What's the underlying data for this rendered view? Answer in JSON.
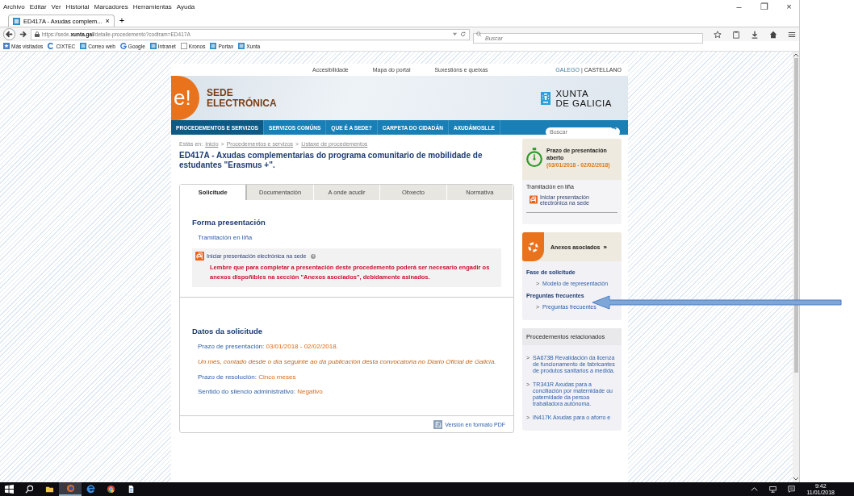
{
  "browser": {
    "menu": [
      "Archivo",
      "Editar",
      "Ver",
      "Historial",
      "Marcadores",
      "Herramientas",
      "Ayuda"
    ],
    "window_controls": [
      "–",
      "❐",
      "×"
    ],
    "tab": {
      "title": "ED417A - Axudas complem...",
      "close": "×",
      "new_tab": "+"
    },
    "address": "https://sede.**xunta.gal**/detalle-procedemento?codtram=ED417A",
    "search": {
      "placeholder": "Buscar"
    },
    "bookmarks": [
      {
        "label": "Más visitados",
        "kind": "star"
      },
      {
        "label": "CIXTEC",
        "kind": "c"
      },
      {
        "label": "Correo web",
        "kind": "page"
      },
      {
        "label": "Google",
        "kind": "g"
      },
      {
        "label": "Intranet",
        "kind": "page"
      },
      {
        "label": "Kronos",
        "kind": "blank"
      },
      {
        "label": "Portax",
        "kind": "page"
      },
      {
        "label": "Xunta",
        "kind": "page"
      }
    ]
  },
  "site": {
    "top_links": [
      "Accesibilidade",
      "Mapa do portal",
      "Suxestións e queixas"
    ],
    "languages": [
      {
        "label": "GALEGO",
        "selected": true
      },
      {
        "label": "CASTELLANO",
        "selected": false
      }
    ],
    "separator": "|",
    "logo": {
      "mark": "e!",
      "lines": [
        "SEDE",
        "ELECTRÓNICA"
      ]
    },
    "xunta": [
      "XUNTA",
      "DE GALICIA"
    ],
    "nav": [
      {
        "label": "PROCEDEMENTOS E SERVIZOS",
        "selected": true
      },
      {
        "label": "SERVIZOS COMÚNS",
        "selected": false
      },
      {
        "label": "QUE É A SEDE?",
        "selected": false
      },
      {
        "label": "CARPETA DO CIDADÁN",
        "selected": false
      },
      {
        "label": "AXUDÁMOSLLE",
        "selected": false
      }
    ],
    "search": {
      "placeholder": "Buscar"
    },
    "breadcrumb": {
      "label": "Estás en:",
      "links": [
        "Inicio",
        "Procedementos e servizos",
        "Listaxe de procedementos"
      ],
      "separator": ">"
    },
    "title": "ED417A - Axudas complementarias do programa comunitario de mobilidade de estudantes \"Erasmus +\".",
    "tabs": [
      {
        "label": "Solicitude",
        "selected": true
      },
      {
        "label": "Documentación",
        "selected": false
      },
      {
        "label": "A onde acudir",
        "selected": false
      },
      {
        "label": "Obxecto",
        "selected": false
      },
      {
        "label": "Normativa",
        "selected": false
      }
    ],
    "forma": {
      "heading": "Forma presentación",
      "subheading": "Tramitación en liña",
      "link": "Iniciar presentación electrónica na sede",
      "warning": "Lembre que para completar a presentación deste procedemento poderá ser necesario engadir os anexos dispoñibles na sección \"Anexos asociados\", debidamente asinados."
    },
    "datos": {
      "heading": "Datos da solicitude",
      "fields": [
        {
          "label": "Prazo de presentación:",
          "value": "03/01/2018 - 02/02/2018."
        },
        {
          "label": "Prazo de resolución:",
          "value": "Cinco meses"
        },
        {
          "label": "Sentido do silencio administrativo:",
          "value": "Negativo"
        }
      ],
      "note": "Un mes, contado desde o día seguinte ao da publicación desta convocatoria no Diario Oficial de Galicia."
    },
    "pdf_link": "Versión en formato PDF",
    "status": {
      "title": "Prazo de presentación aberto",
      "dates": "(03/01/2018 - 02/02/2018)",
      "online_label": "Tramitación en liña",
      "online_link": "Iniciar presentación electrónica na sede"
    },
    "anexos": {
      "title": "Anexos asociados",
      "more": "»",
      "marker": ">",
      "groups": [
        {
          "heading": "Fase de solicitude",
          "links": [
            "Modelo de representación"
          ]
        },
        {
          "heading": "Preguntas frecuentes",
          "links": [
            "Preguntas frecuentes"
          ]
        }
      ]
    },
    "related": {
      "title": "Procedementos relacionados",
      "marker": ">",
      "items": [
        "SA673B Revalidación da licenza de funcionamento de fabricantes de produtos sanitarios a medida.",
        "TR341R Axudas para a conciliación por maternidade ou paternidade da persoa traballadora autónoma.",
        "IN417K Axudas para o aforro e"
      ]
    }
  },
  "taskbar": {
    "time": "9:42",
    "date": "11/01/2018"
  }
}
